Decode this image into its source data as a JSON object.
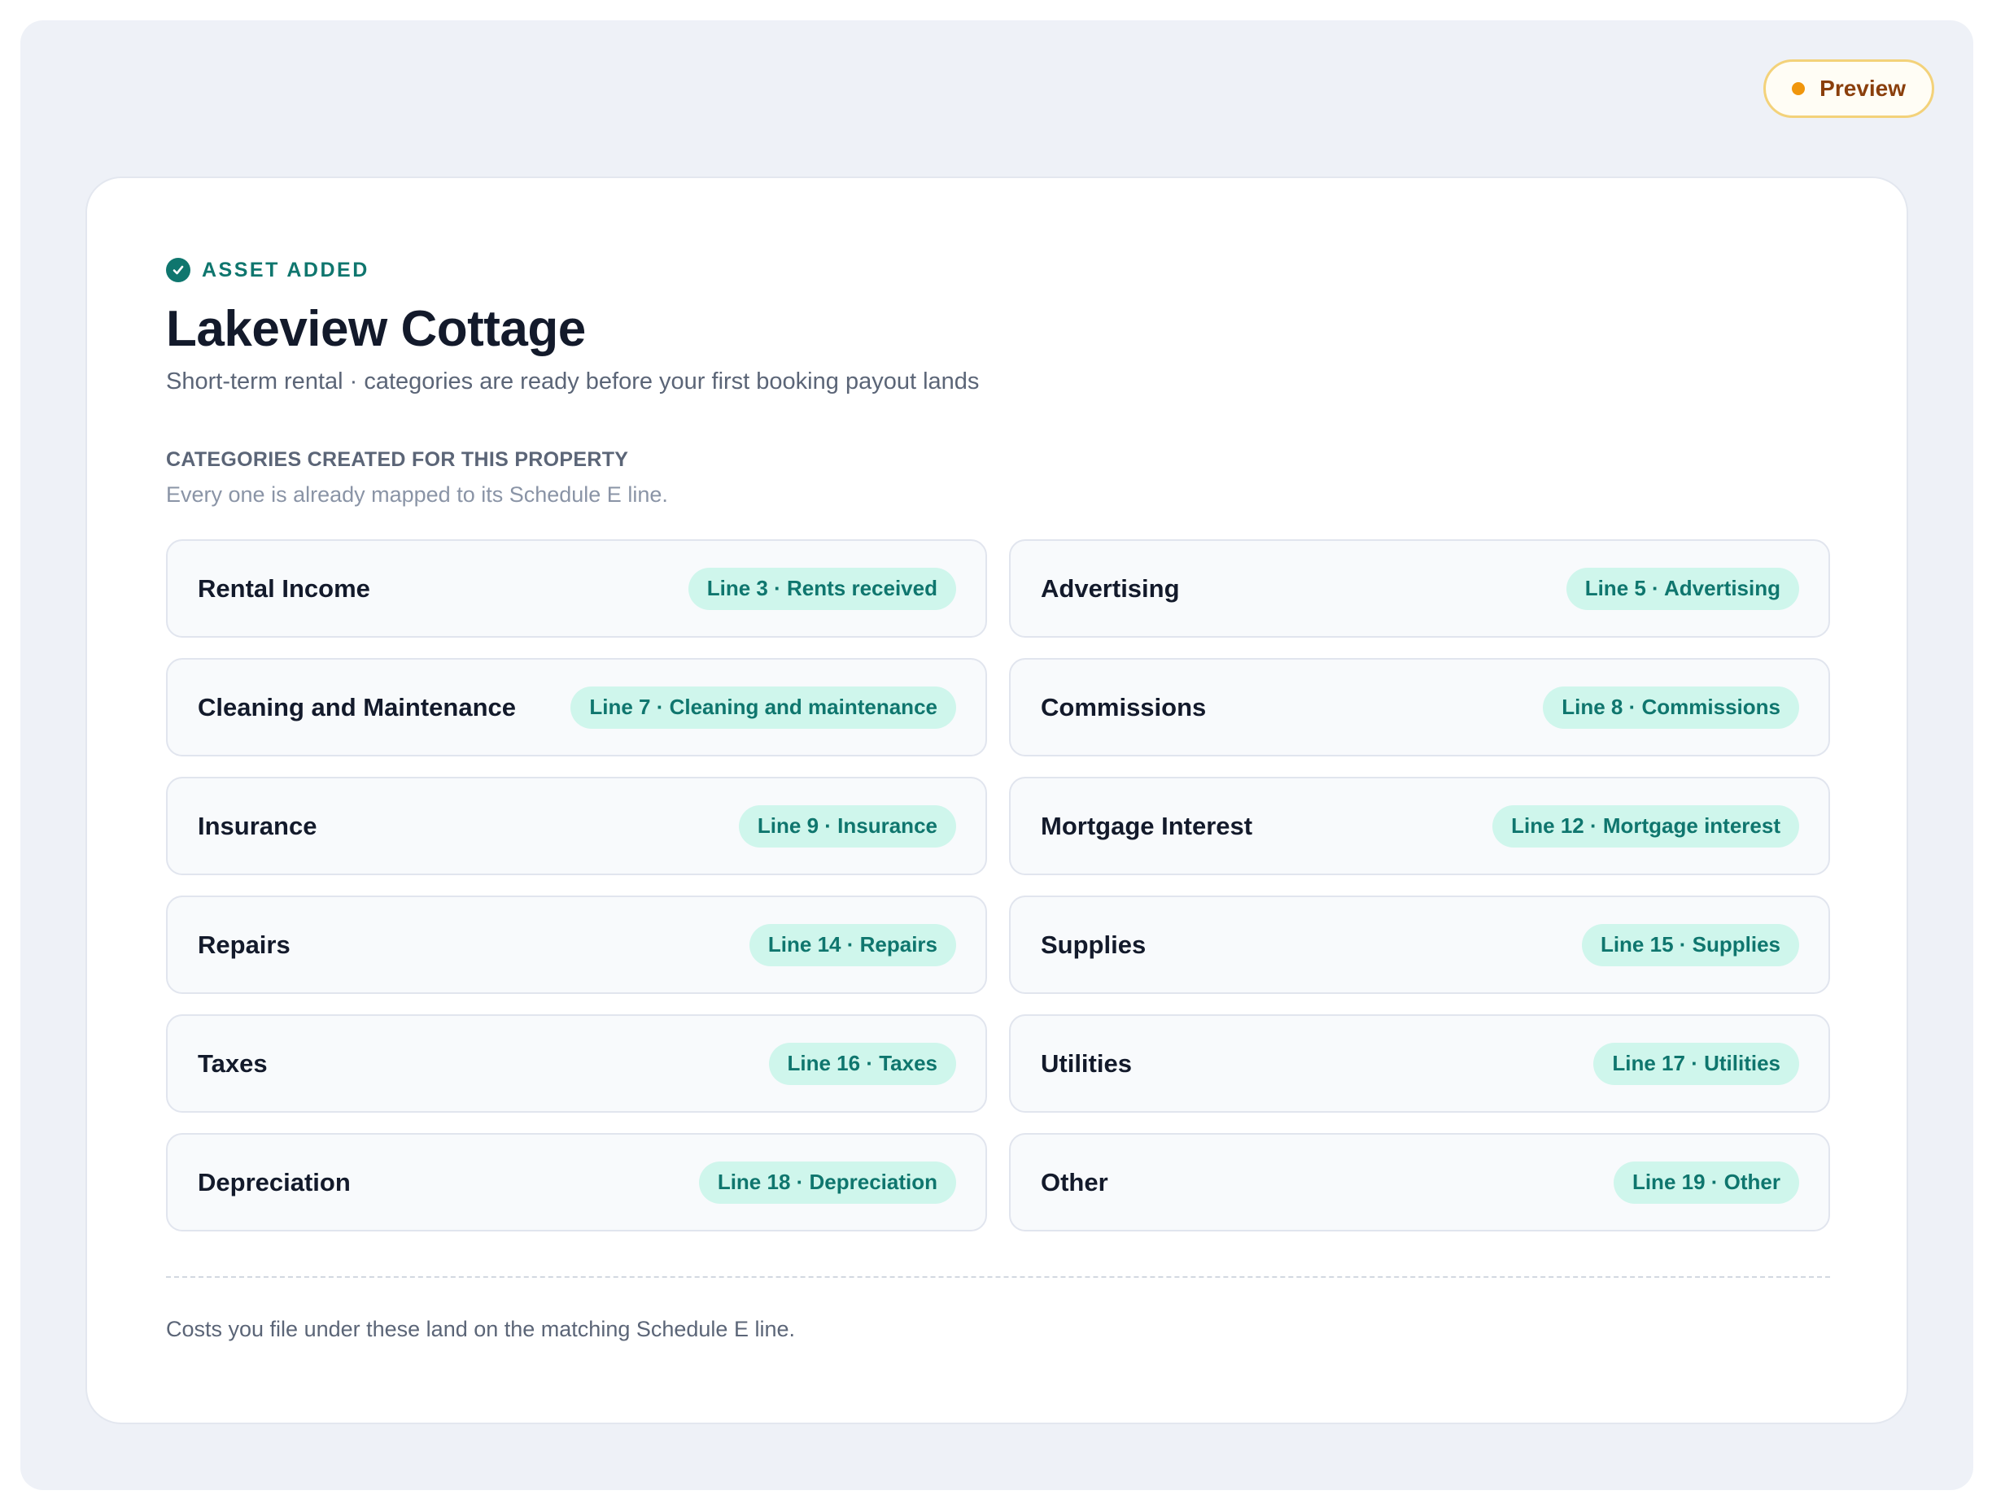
{
  "header": {
    "preview_label": "Preview"
  },
  "card": {
    "status_label": "ASSET ADDED",
    "title": "Lakeview Cottage",
    "subtitle": "Short-term rental · categories are ready before your first booking payout lands",
    "section_label": "CATEGORIES CREATED FOR THIS PROPERTY",
    "section_hint": "Every one is already mapped to its Schedule E line.",
    "categories": [
      {
        "name": "Rental Income",
        "line": "Line 3 · Rents received"
      },
      {
        "name": "Advertising",
        "line": "Line 5 · Advertising"
      },
      {
        "name": "Cleaning and Maintenance",
        "line": "Line 7 · Cleaning and maintenance"
      },
      {
        "name": "Commissions",
        "line": "Line 8 · Commissions"
      },
      {
        "name": "Insurance",
        "line": "Line 9 · Insurance"
      },
      {
        "name": "Mortgage Interest",
        "line": "Line 12 · Mortgage interest"
      },
      {
        "name": "Repairs",
        "line": "Line 14 · Repairs"
      },
      {
        "name": "Supplies",
        "line": "Line 15 · Supplies"
      },
      {
        "name": "Taxes",
        "line": "Line 16 · Taxes"
      },
      {
        "name": "Utilities",
        "line": "Line 17 · Utilities"
      },
      {
        "name": "Depreciation",
        "line": "Line 18 · Depreciation"
      },
      {
        "name": "Other",
        "line": "Line 19 · Other"
      }
    ],
    "footnote": "Costs you file under these land on the matching Schedule E line."
  },
  "icons": {
    "status": "check-circle-icon",
    "preview": "status-dot-icon"
  },
  "colors": {
    "accent": "#0f766e",
    "badge_bg": "#cff6ec",
    "preview_dot": "#f0960c",
    "preview_text": "#8a3f0c",
    "page_bg": "#eef1f7"
  }
}
